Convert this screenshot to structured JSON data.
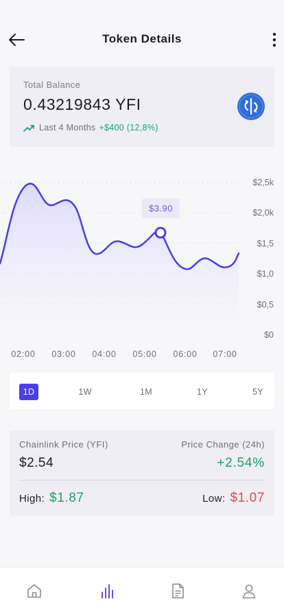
{
  "header": {
    "title": "Token Details"
  },
  "balance": {
    "label": "Total Balance",
    "amount": "0.43219843 YFI",
    "period": "Last 4 Months",
    "change": "+$400 (12,8%)",
    "logo_icon": "yfi-logo-icon",
    "logo_color": "#2f6ed8"
  },
  "chart_data": {
    "type": "line",
    "x_ticks": [
      "02:00",
      "03:00",
      "04:00",
      "05:00",
      "06:00",
      "07:00"
    ],
    "y_ticks": [
      "$2,5k",
      "$2,0k",
      "$1,5",
      "$1,0",
      "$0,5",
      "$0"
    ],
    "highlight_label": "$3.90",
    "line_color": "#4c3ee8",
    "grid": true
  },
  "range_tabs": [
    {
      "label": "1D",
      "active": true
    },
    {
      "label": "1W",
      "active": false
    },
    {
      "label": "1M",
      "active": false
    },
    {
      "label": "1Y",
      "active": false
    },
    {
      "label": "5Y",
      "active": false
    }
  ],
  "price_card": {
    "price_label": "Chainlink Price (YFI)",
    "price_value": "$2.54",
    "change_label": "Price Change (24h)",
    "change_value": "+2.54%",
    "high_label": "High:",
    "high_value": "$1.87",
    "low_label": "Low:",
    "low_value": "$1.07"
  },
  "nav": [
    {
      "icon": "home-icon"
    },
    {
      "icon": "chart-bars-icon",
      "active": true
    },
    {
      "icon": "document-icon"
    },
    {
      "icon": "profile-icon"
    }
  ],
  "colors": {
    "accent": "#4c3ee8",
    "positive": "#1aa36a",
    "negative": "#e24a4a"
  }
}
